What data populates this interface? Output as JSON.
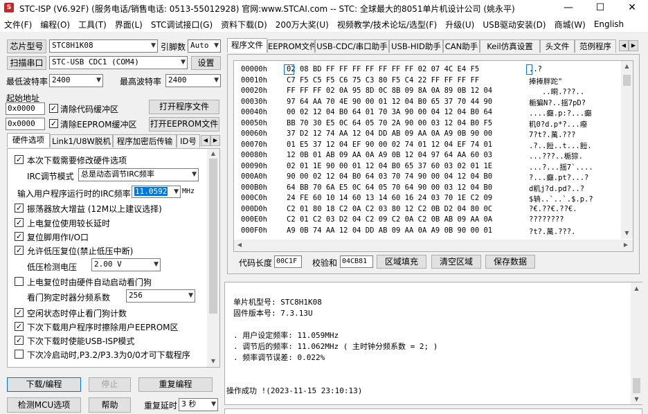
{
  "window": {
    "title": "STC-ISP (V6.92F)  (服务电话/销售电话: 0513-55012928)  官网:www.STCAI.com   -- STC: 全球最大的8051单片机设计公司 (姚永平)",
    "minimize_glyph": "—",
    "maximize_glyph": "☐",
    "close_glyph": "✕"
  },
  "menu": [
    "文件(F)",
    "编程(O)",
    "工具(T)",
    "界面(L)",
    "STC调试接口(G)",
    "资料下载(D)",
    "200万大奖(U)",
    "视频教学/技术论坛/选型(F)",
    "升级(U)",
    "USB驱动安装(D)",
    "商城(W)",
    "English"
  ],
  "left": {
    "chip_model_btn": "芯片型号",
    "chip_model_value": "STC8H1K08",
    "pin_count_label": "引脚数",
    "pin_count_value": "Auto",
    "scan_port_btn": "扫描串口",
    "port_value": "STC-USB CDC1 (COM4)",
    "settings_btn": "设置",
    "min_baud_label": "最低波特率",
    "min_baud_value": "2400",
    "max_baud_label": "最高波特率",
    "max_baud_value": "2400",
    "start_addr_label": "起始地址",
    "code_addr": "0x0000",
    "clear_code_label": "清除代码缓冲区",
    "open_program_btn": "打开程序文件",
    "eeprom_addr": "0x0000",
    "clear_eeprom_label": "清除EEPROM缓冲区",
    "open_eeprom_btn": "打开EEPROM文件",
    "tabs": [
      "硬件选项",
      "Link1/U8W脱机",
      "程序加密后传输",
      "ID号"
    ],
    "options": {
      "modify_hw": "本次下载需要修改硬件选项",
      "irc_mode_label": "IRC调节模式",
      "irc_mode_value": "总是动态调节IRC频率",
      "irc_freq_label": "输入用户程序运行时的IRC频率",
      "irc_freq_value": "11.0592",
      "irc_freq_unit": "MHz",
      "osc_gain": "振荡器放大增益 (12M以上建议选择)",
      "long_reset": "上电复位使用较长延时",
      "reset_pin_io": "复位脚用作I/O口",
      "low_volt_reset": "允许低压复位(禁止低压中断)",
      "low_volt_label": "低压检测电压",
      "low_volt_value": "2.00 V",
      "wdt_auto": "上电复位时由硬件自动启动看门狗",
      "wdt_div_label": "看门狗定时器分频系数",
      "wdt_div_value": "256",
      "idle_wdt_stop": "空闲状态时停止看门狗计数",
      "erase_eeprom": "下次下载用户程序时擦除用户EEPROM区",
      "usb_isp": "下次下载时使能USB-ISP模式",
      "cold_boot": "下次冷启动时,P3.2/P3.3为0/0才可下载程序"
    },
    "download_btn": "下载/编程",
    "stop_btn": "停止",
    "reprogram_btn": "重复编程",
    "detect_btn": "检测MCU选项",
    "help_btn": "帮助",
    "repeat_delay_label": "重复延时",
    "repeat_delay_value": "3 秒"
  },
  "right": {
    "tabs": [
      "程序文件",
      "EEPROM文件",
      "USB-CDC/串口助手",
      "USB-HID助手",
      "CAN助手",
      "Keil仿真设置",
      "头文件",
      "范例程序"
    ],
    "hex_rows": [
      {
        "addr": "00000h",
        "bytes": "02 08 BD FF FF FF FF FF FF FF 02 07 4C E4 F5",
        "ascii": "..?"
      },
      {
        "addr": "00010h",
        "bytes": "C7 F5 C5 F5 C6 75 C3 80 F5 C4 22 FF FF FF FF",
        "ascii": "捧捧胖跎\""
      },
      {
        "addr": "00020h",
        "bytes": "FF FF FF 02 0A 95 8D 0C 8B 09 8A 0A 89 0B 12 04",
        "ascii": "   ..晍.???.."
      },
      {
        "addr": "00030h",
        "bytes": "97 64 AA 70 4E 90 00 01 12 04 B0 65 37 70 44 90",
        "ascii": "梔猵N?..揺7pD?"
      },
      {
        "addr": "00040h",
        "bytes": "00 02 12 04 B0 64 01 70 3A 90 00 04 12 04 B0 64",
        "ascii": "....癲.p:?...癲"
      },
      {
        "addr": "00050h",
        "bytes": "BB 70 30 E5 0C 64 05 70 2A 90 00 03 12 04 B0 F5",
        "ascii": "籶0?d.p*?...癈"
      },
      {
        "addr": "00060h",
        "bytes": "37 D2 12 74 AA 12 04 DD AB 09 AA 0A A9 0B 90 00",
        "ascii": "7?t?.萬.???"
      },
      {
        "addr": "00070h",
        "bytes": "01 E5 37 12 04 EF 90 00 02 74 01 12 04 EF 74 01",
        "ascii": ".?..餖..t...餖."
      },
      {
        "addr": "00080h",
        "bytes": "12 0B 01 AB 09 AA 0A A9 0B 12 04 97 64 AA 60 03",
        "ascii": "...???..梔猔."
      },
      {
        "addr": "00090h",
        "bytes": "02 01 1E 90 00 01 12 04 B0 65 37 60 03 02 01 1E",
        "ascii": "...?...揺7`...."
      },
      {
        "addr": "000A0h",
        "bytes": "90 00 02 12 04 B0 64 03 70 74 90 00 04 12 04 B0",
        "ascii": "?...癲.pt?...?"
      },
      {
        "addr": "000B0h",
        "bytes": "64 BB 70 6A E5 0C 64 05 70 64 90 00 03 12 04 B0",
        "ascii": "d籶j?d.pd?..?"
      },
      {
        "addr": "000C0h",
        "bytes": "24 FE 60 10 14 60 13 14 60 16 24 03 70 1E C2 09",
        "ascii": "$辀..`..`.$.p.?"
      },
      {
        "addr": "000D0h",
        "bytes": "C2 01 80 18 C2 0A C2 03 80 12 C2 0B D2 04 80 0C",
        "ascii": "?€.??€.??€."
      },
      {
        "addr": "000E0h",
        "bytes": "C2 01 C2 03 D2 04 C2 09 C2 0A C2 0B AB 09 AA 0A",
        "ascii": "????????"
      },
      {
        "addr": "000F0h",
        "bytes": "A9 0B 74 AA 12 04 DD AB 09 AA 0A A9 0B 90 00 01",
        "ascii": "?t?.萬.???."
      }
    ],
    "code_len_label": "代码长度",
    "code_len_value": "00C1F",
    "checksum_label": "校验和",
    "checksum_value": "04CB81",
    "fill_btn": "区域填充",
    "clear_btn": "清空区域",
    "save_btn": "保存数据",
    "log_lines": [
      "单片机型号: STC8H1K08",
      "固件版本号: 7.3.13U",
      "",
      ". 用户设定频率: 11.059MHz",
      ". 调节后的频率: 11.062MHz ( 主时钟分频系数 = 2; )",
      ". 频率调节误差: 0.022%"
    ],
    "log_success": "操作成功 !(2023-11-15 23:10:13)"
  }
}
